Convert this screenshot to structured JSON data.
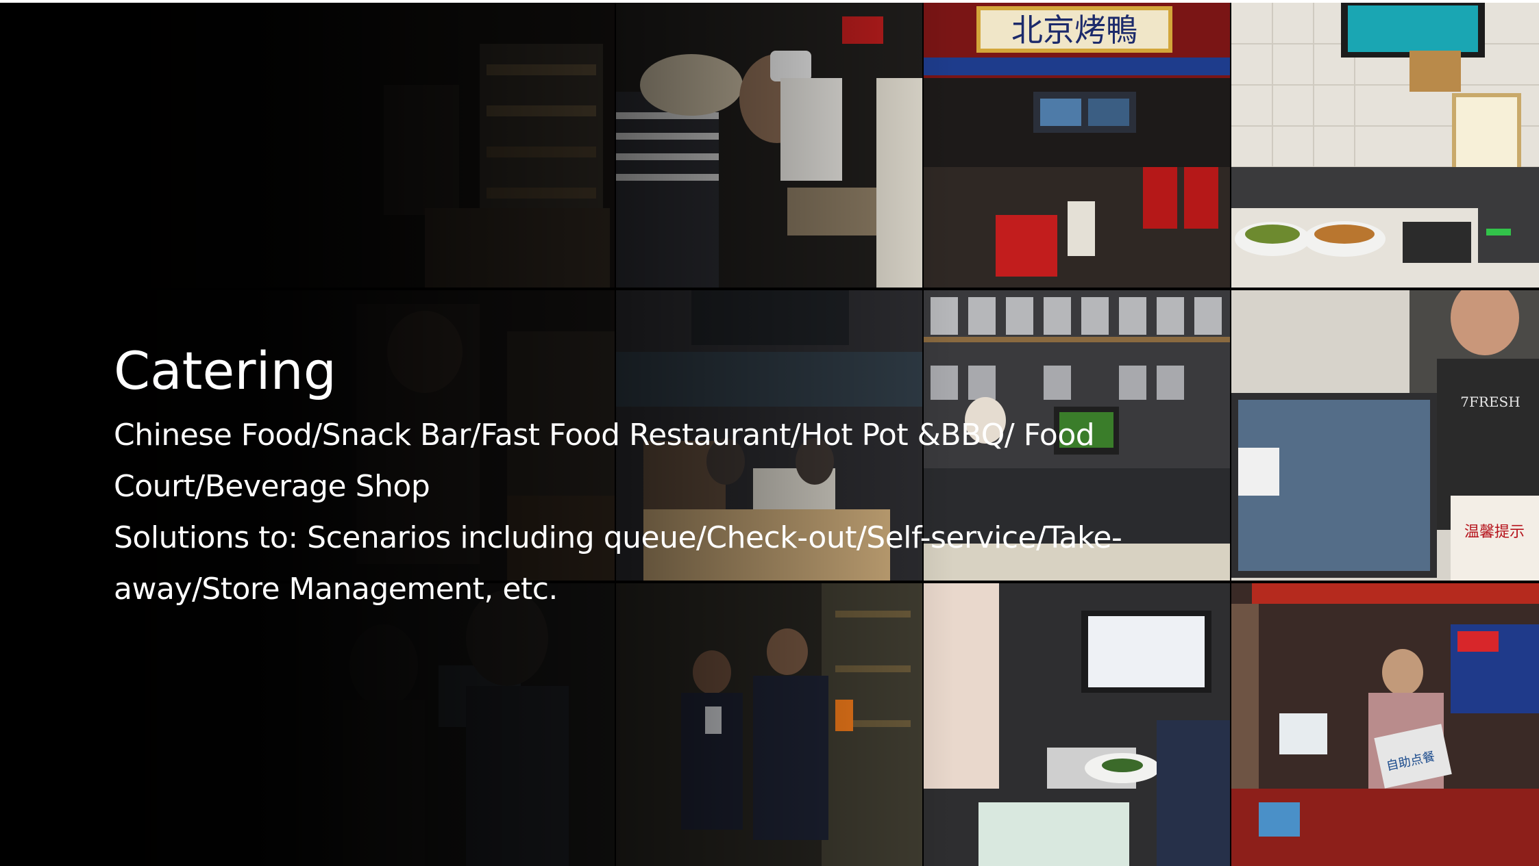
{
  "slide": {
    "title": "Catering",
    "description_lines": [
      "Chinese Food/Snack Bar/Fast Food Restaurant/Hot Pot &BBQ/ Food",
      "Court/Beverage Shop",
      "Solutions to: Scenarios including queue/Check-out/Self-service/Take-",
      "away/Store Management, etc."
    ],
    "photo_signage": {
      "roast_duck_sign": "北京烤鴨",
      "counter_logo": "7FRESH",
      "promo_banner": "温馨提示",
      "self_order_screen": "自助点餐"
    }
  },
  "colors": {
    "background": "#000000",
    "text": "#ffffff",
    "sign_red": "#b5121b",
    "sign_gold": "#e8c66a"
  }
}
